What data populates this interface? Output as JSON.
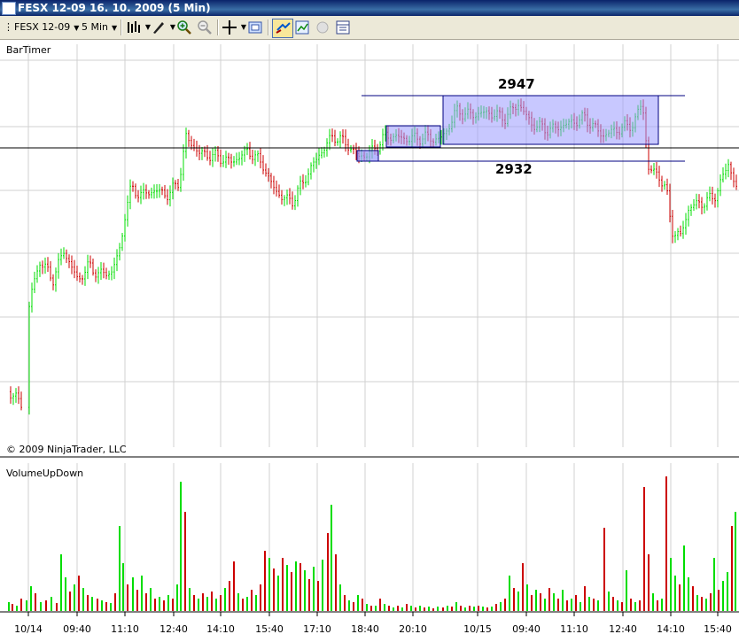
{
  "window": {
    "title": "FESX 12-09  16. 10. 2009 (5 Min)"
  },
  "toolbar": {
    "instrument": "FESX 12-09",
    "interval": "5 Min",
    "icons": [
      "bar-type-icon",
      "draw-tool-icon",
      "zoom-in-icon",
      "zoom-out-icon",
      "crosshair-icon",
      "properties-icon",
      "strategy-icon",
      "chart-trader-icon",
      "record-icon",
      "data-box-icon"
    ]
  },
  "indicators": {
    "top": "BarTimer",
    "bottom": "VolumeUpDown"
  },
  "copyright": "© 2009 NinjaTrader, LLC",
  "time_axis": [
    "10/14",
    "09:40",
    "11:10",
    "12:40",
    "14:10",
    "15:40",
    "17:10",
    "18:40",
    "20:10",
    "10/15",
    "09:40",
    "11:10",
    "12:40",
    "14:10",
    "15:40"
  ],
  "annotations": {
    "upper_level": "2947",
    "lower_level": "2932"
  },
  "colors": {
    "up": "#00dd00",
    "down": "#cc0000",
    "box_fill": "#9a9aff",
    "box_line": "#000080",
    "grid": "#d0d0d0"
  },
  "chart_data": {
    "type": "candlestick",
    "price_levels": [
      2947,
      2932
    ],
    "volume_colors": "green = up volume, red = down volume"
  }
}
